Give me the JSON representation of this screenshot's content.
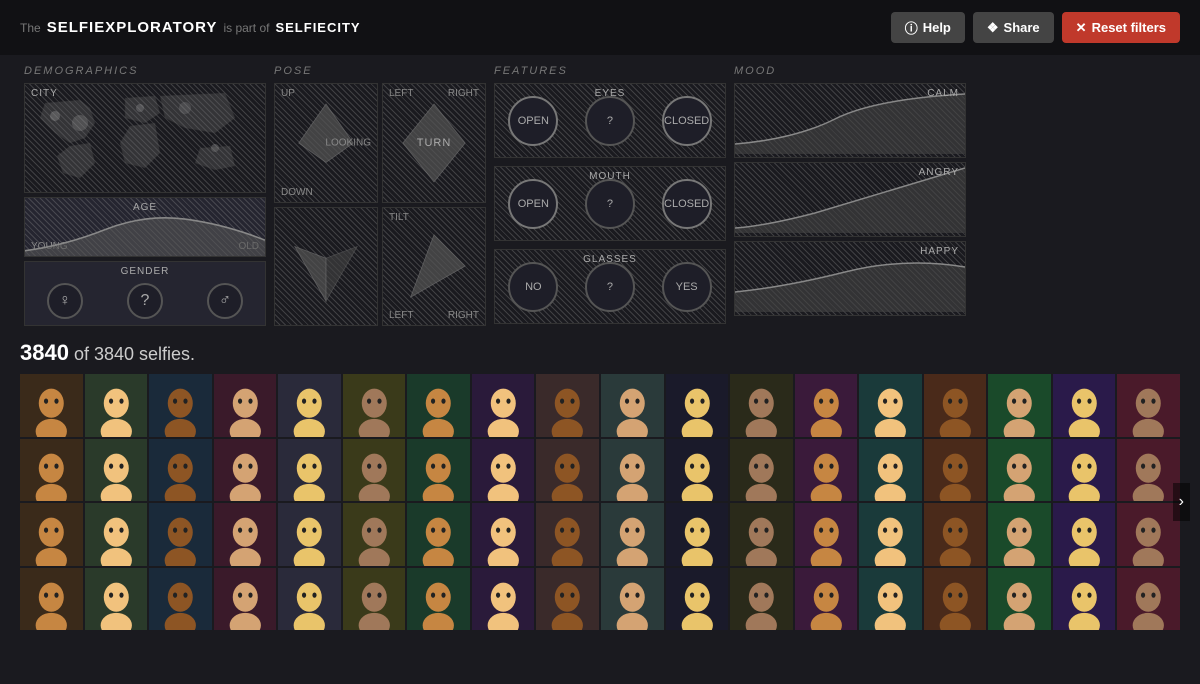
{
  "header": {
    "the_label": "The",
    "brand_name": "SELFIEXPLORATORY",
    "is_part_of": "is part of",
    "selfiecity": "SELFIECITY",
    "help_btn": "Help",
    "share_btn": "Share",
    "reset_btn": "Reset filters"
  },
  "sections": {
    "demographics_title": "DEMOGRAPHICS",
    "pose_title": "POSE",
    "features_title": "FEATURES",
    "mood_title": "MOOD"
  },
  "demographics": {
    "city_label": "CITY",
    "age_label": "AGE",
    "young_label": "YOUNG",
    "old_label": "OLD",
    "gender_label": "GENDER"
  },
  "pose": {
    "up_label": "UP",
    "down_label": "DOWN",
    "left_label": "LEFT",
    "right_label": "RIGHT",
    "turn_label": "TURN",
    "looking_label": "LOOKING",
    "tilt_label": "TILT",
    "left2_label": "LEFT",
    "right2_label": "RIGHT"
  },
  "features": {
    "eyes_label": "EYES",
    "mouth_label": "MOUTH",
    "glasses_label": "GLASSES",
    "open_label": "OPEN",
    "closed_label": "CLOSED",
    "question_label": "?",
    "no_label": "NO",
    "yes_label": "YES"
  },
  "mood": {
    "calm_label": "CALM",
    "angry_label": "ANGRY",
    "happy_label": "HAPPY"
  },
  "results": {
    "count": "3840",
    "total": "3840",
    "label": "of 3840 selfies."
  },
  "colors": {
    "bg": "#1a1a1f",
    "panel": "#252530",
    "border": "#333333",
    "accent": "#c0392b"
  },
  "photos": {
    "row_count": 4,
    "col_count": 18
  }
}
